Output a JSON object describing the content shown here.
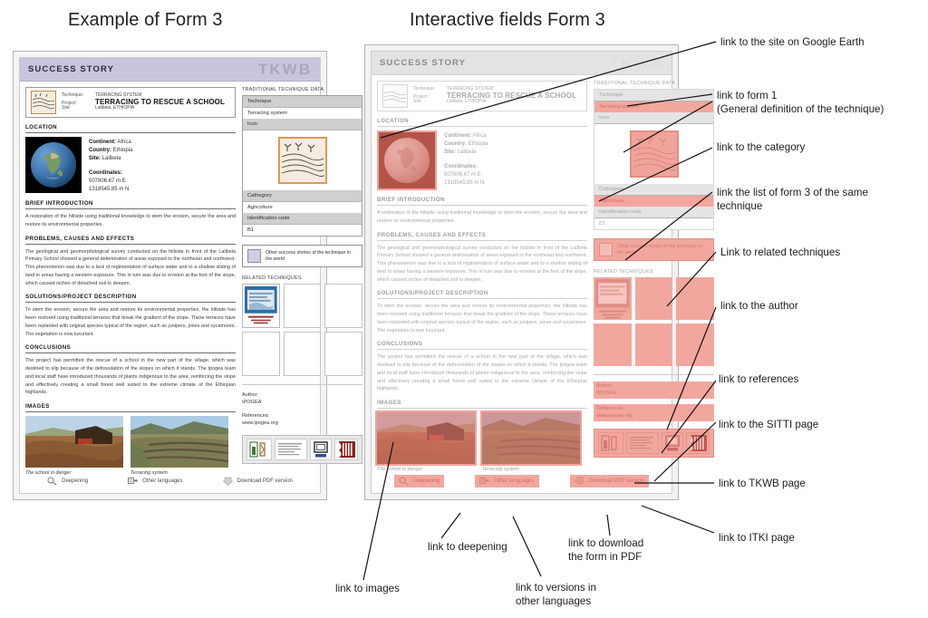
{
  "captions": {
    "left": "Example of Form 3",
    "right": "Interactive fields Form 3"
  },
  "form": {
    "titlebar": {
      "title": "SUCCESS STORY",
      "brand": "TKWB"
    },
    "technique_header": {
      "labels": {
        "technique": "Technique:",
        "project": "Project:",
        "site": "Site:"
      },
      "values": {
        "technique": "TERRACING SYSTEM",
        "project": "TERRACING TO RESCUE A SCHOOL",
        "site": "Lalibela, ETHIOPIA"
      }
    },
    "sections": {
      "location": "LOCATION",
      "brief_introduction": "BRIEF INTRODUCTION",
      "problems": "PROBLEMS, CAUSES AND EFFECTS",
      "solutions": "SOLUTIONS/PROJECT DESCRIPTION",
      "conclusions": "CONCLUSIONS",
      "images": "IMAGES"
    },
    "location": {
      "continent_label": "Continent:",
      "continent_value": "Africa",
      "country_label": "Country:",
      "country_value": "Ethiopia",
      "site_label": "Site:",
      "site_value": "Lalibela",
      "coordinates_label": "Coordinates:",
      "coord_easting": "507806.67 m E",
      "coord_northing": "1318545.85 m N"
    },
    "texts": {
      "brief_introduction": "A restoration of the hillside using traditional knowledge to stem the erosion, secure the area and restore its environmental properties.",
      "problems": "The geological and geomorphological survey conducted on the hillside in front of the Lalibela Primary School showed a general deterioration of areas exposed to the northeast and northwest. This phenomenon was due to a lack of regimentation of surface water and to a shallow sliding of land in areas having a western exposure. This in turn was due to erosion at the foot of the slope, which caused niches of detached soil to deepen.",
      "solutions": "To stem the erosion, secure the area and restore its environmental properties, the hillside has been restored using traditional terraces that break the gradient of the slope. These terraces have been replanted with original species typical of the region, such as junipers, pines and sycamores. The vegetation is now luxuriant.",
      "conclusions": "The project has permitted the rescue of a school in the new part of the village, which was destined to slip because of the deforestation of the slopes on which it stands. The Ipogea team and local staff have introduced thousands of plants indigenous to the area, reinforcing the slope and effectively creating a small forest well suited to the extreme climate of the Ethiopian highlands."
    },
    "images": [
      {
        "caption": "The school in danger"
      },
      {
        "caption": "Terracing system"
      }
    ],
    "sidebar": {
      "panel_title": "TRADITIONAL TECHNIQUE DATA",
      "rows": [
        {
          "header": "Technique",
          "value": "Terracing system"
        },
        {
          "header": "Icon",
          "value": ""
        },
        {
          "header": "Cathegory",
          "value": "Agricolture"
        },
        {
          "header": "Identification code",
          "value": "B1"
        }
      ],
      "other_stories": "Other success stories of the technique in the world",
      "related_title": "RELATED TECHNIQUES",
      "author_label": "Author:",
      "author_value": "IPOGEA",
      "references_label": "References:",
      "references_value": "www.ipogea.org"
    },
    "toolbar": [
      {
        "label": "Deepening",
        "icon": "magnifier-icon"
      },
      {
        "label": "Other languages",
        "icon": "languages-icon"
      },
      {
        "label": "Download PDF version",
        "icon": "download-icon"
      }
    ]
  },
  "annotations": [
    {
      "id": "google-earth",
      "text": "link to the site on Google Earth"
    },
    {
      "id": "form-1",
      "text": "link to form 1\n(General definition of the technique)"
    },
    {
      "id": "category",
      "text": "link to the category"
    },
    {
      "id": "same-technique-list",
      "text": "link the list of form 3 of the same\ntechnique"
    },
    {
      "id": "related-techniques",
      "text": "Link to related techniques"
    },
    {
      "id": "author",
      "text": "link to the author"
    },
    {
      "id": "references",
      "text": "link to references"
    },
    {
      "id": "sitti",
      "text": "link to the SITTI page"
    },
    {
      "id": "tkwb",
      "text": "link to TKWB page"
    },
    {
      "id": "itki",
      "text": "link to ITKI page"
    },
    {
      "id": "images",
      "text": "link to images"
    },
    {
      "id": "deepening",
      "text": "link to deepening"
    },
    {
      "id": "other-languages",
      "text": "link to versions in\nother languages"
    },
    {
      "id": "download-pdf",
      "text": "link to download\nthe form in PDF"
    }
  ],
  "colors": {
    "titlebar_lavender": "#c7c6de",
    "highlight_pink": "#f2a79e",
    "panel_grey": "#cfcfcf"
  }
}
